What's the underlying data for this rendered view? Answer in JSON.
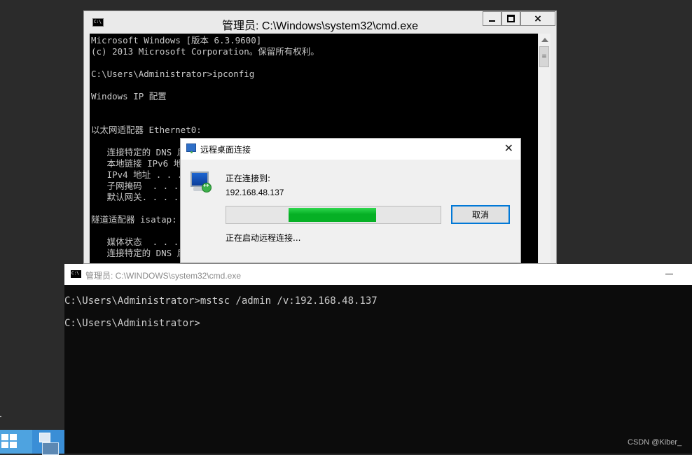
{
  "back_cmd": {
    "title": "管理员: C:\\Windows\\system32\\cmd.exe",
    "icon_label": "C:\\",
    "console_text": "Microsoft Windows [版本 6.3.9600]\n(c) 2013 Microsoft Corporation。保留所有权利。\n\nC:\\Users\\Administrator>ipconfig\n\nWindows IP 配置\n\n\n以太网适配器 Ethernet0:\n\n   连接特定的 DNS 后缀 . . . . . . . :\n   本地链接 IPv6 地址. . . . . . . . :\n   IPv4 地址 . . . . . . . . . . . . :\n   子网掩码  . . . . . . . . . . . . :\n   默认网关. . . . . . . . . . . . . :\n\n隧道适配器 isatap:\n\n   媒体状态  . . . . . . . . . . . . :\n   连接特定的 DNS 后缀 . . . . . . . :",
    "buttons": {
      "minimize": "minimize",
      "maximize": "maximize",
      "close": "×"
    }
  },
  "rdp_dialog": {
    "title": "远程桌面连接",
    "connecting_label": "正在连接到:",
    "target_ip": "192.168.48.137",
    "progress": {
      "fill_start": 0.29,
      "fill_end": 0.7,
      "color": "#06b025"
    },
    "cancel_label": "取消",
    "status_text": "正在启动远程连接...",
    "close_label": "✕"
  },
  "front_cmd": {
    "title": "管理员: C:\\WINDOWS\\system32\\cmd.exe",
    "icon_label": "C:\\",
    "console_text": "C:\\Users\\Administrator>mstsc /admin /v:192.168.48.137\n\nC:\\Users\\Administrator>"
  },
  "taskbar": {
    "start_icon": "windows-logo-icon",
    "pinned_app_icon": "server-manager-icon"
  },
  "watermark": "CSDN @Kiber_"
}
